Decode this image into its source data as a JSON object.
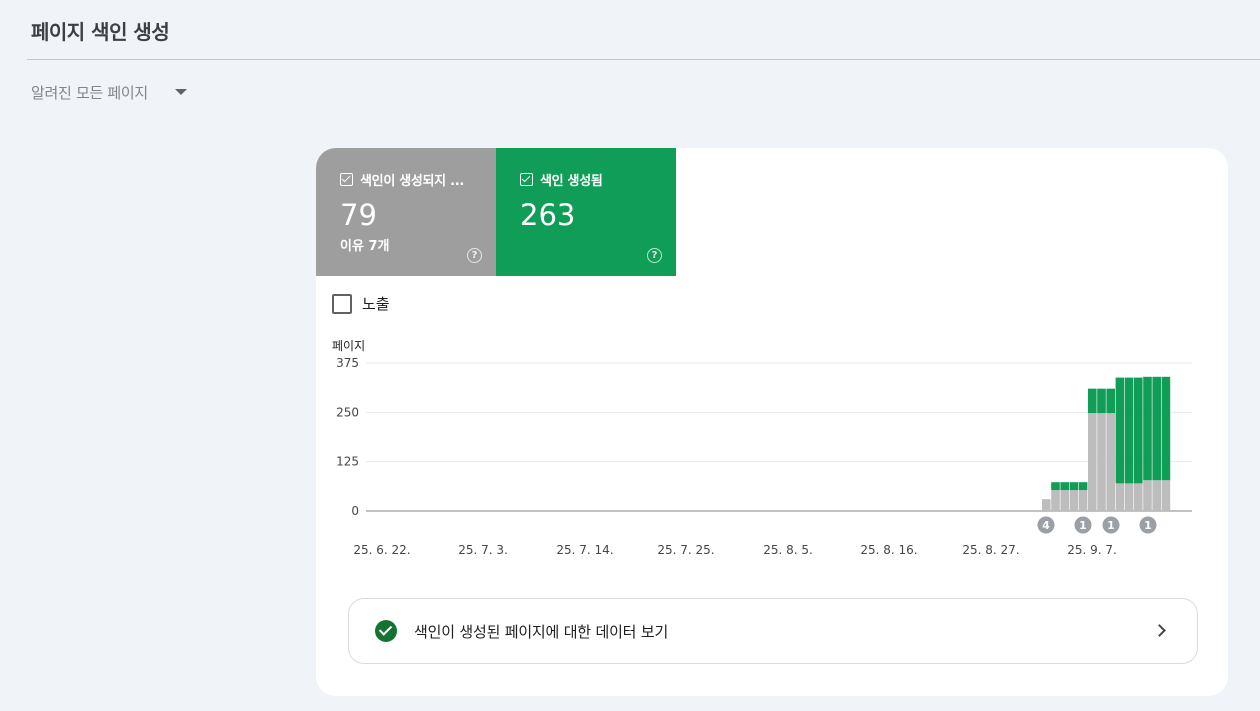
{
  "page": {
    "title": "페이지 색인 생성"
  },
  "filter": {
    "label": "알려진 모든 페이지"
  },
  "tiles": [
    {
      "label": "색인이 생성되지 ...",
      "value": "79",
      "sub": "이유 7개",
      "color": "#9e9e9e"
    },
    {
      "label": "색인 생성됨",
      "value": "263",
      "color": "#0f9d58"
    }
  ],
  "impressions": {
    "label": "노출",
    "checked": false
  },
  "chart_data": {
    "type": "bar",
    "stacked": true,
    "ylabel": "페이지",
    "ylim": [
      0,
      375
    ],
    "yticks": [
      "375",
      "250",
      "125",
      "0"
    ],
    "xticks": [
      "25. 6. 22.",
      "25. 7. 3.",
      "25. 7. 14.",
      "25. 7. 25.",
      "25. 8. 5.",
      "25. 8. 16.",
      "25. 8. 27.",
      "25. 9. 7."
    ],
    "grid": true,
    "series": [
      {
        "name": "색인이 생성되지 ...",
        "color": "#bdbdbd",
        "values": [
          30,
          53,
          53,
          53,
          53,
          248,
          248,
          248,
          70,
          70,
          70,
          78,
          78,
          78
        ]
      },
      {
        "name": "색인 생성됨",
        "color": "#0f9d58",
        "values": [
          0,
          20,
          20,
          20,
          20,
          62,
          62,
          62,
          268,
          268,
          268,
          262,
          262,
          262
        ]
      }
    ],
    "annotations": [
      "4",
      "1",
      "1",
      "1"
    ]
  },
  "cta": {
    "label": "색인이 생성된 페이지에 대한 데이터 보기"
  },
  "colors": {
    "background": "#f0f4f9",
    "accent_green": "#0f9d58",
    "grey": "#9e9e9e"
  }
}
